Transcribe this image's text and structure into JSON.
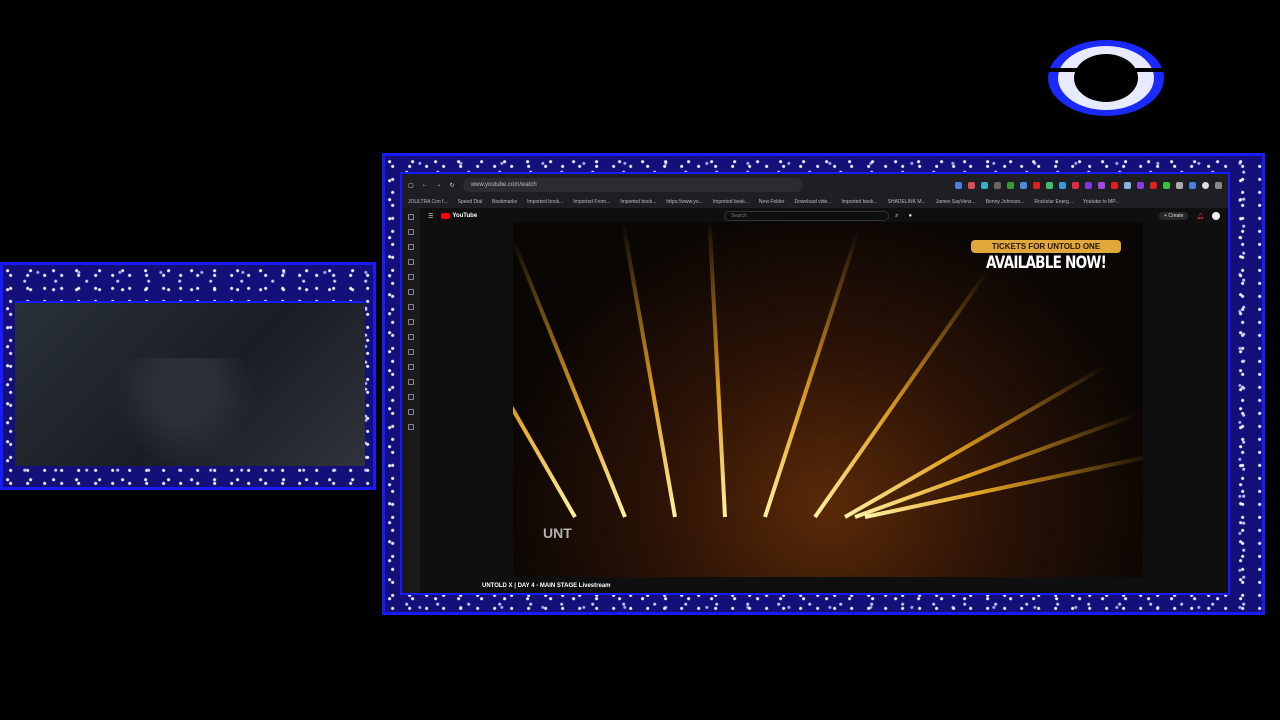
{
  "browser": {
    "url": "www.youtube.com/watch",
    "bookmarks": [
      "JOULTRA Con f...",
      "Speed Dial",
      "Bookmarks",
      "Imported book...",
      "Imported From...",
      "Imported book...",
      "https://www.yo...",
      "Imported book...",
      "New Folder",
      "Download vide...",
      "Imported book...",
      "SHADELINK M...",
      "James SayVenz...",
      "Benny Johnson...",
      "Rockstar Energ...",
      "Youtube to MP..."
    ]
  },
  "youtube": {
    "logo": "YouTube",
    "search_placeholder": "Search",
    "create_label": "+ Create",
    "video_title": "UNTOLD X | DAY 4 - MAIN STAGE Livestream",
    "overlay": {
      "tickets": "TICKETS FOR UNTOLD ONE",
      "available": "AVAILABLE NOW!",
      "watermark": "UNT"
    }
  },
  "colors": {
    "frame": "#1a1aff",
    "youtube_red": "#ff0000"
  }
}
